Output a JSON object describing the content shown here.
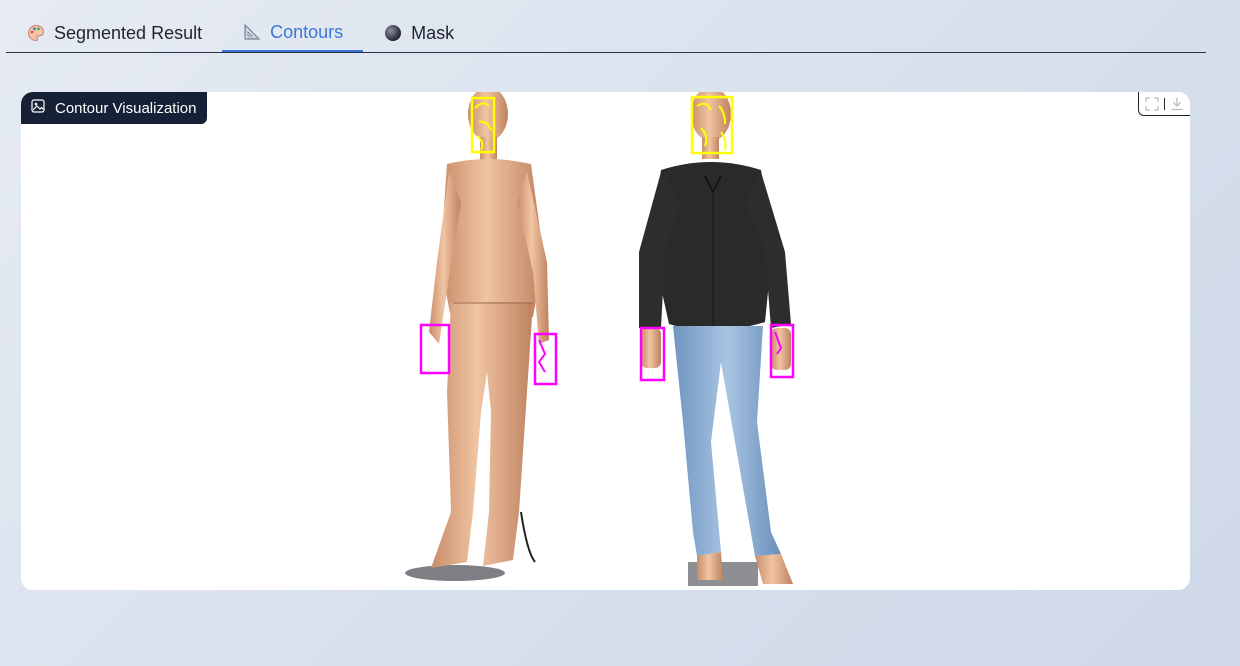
{
  "tabs": [
    {
      "label": "Segmented Result",
      "icon": "palette-icon",
      "active": false
    },
    {
      "label": "Contours",
      "icon": "triangle-ruler-icon",
      "active": true
    },
    {
      "label": "Mask",
      "icon": "dark-circle-icon",
      "active": false
    }
  ],
  "panel": {
    "label": "Contour Visualization",
    "label_icon": "image-icon",
    "tools": [
      "fullscreen-icon",
      "download-icon"
    ]
  },
  "colors": {
    "accent": "#3a78d8",
    "chip_bg": "#162036",
    "face_contour": "#ffff00",
    "hand_contour": "#ff00ff"
  }
}
